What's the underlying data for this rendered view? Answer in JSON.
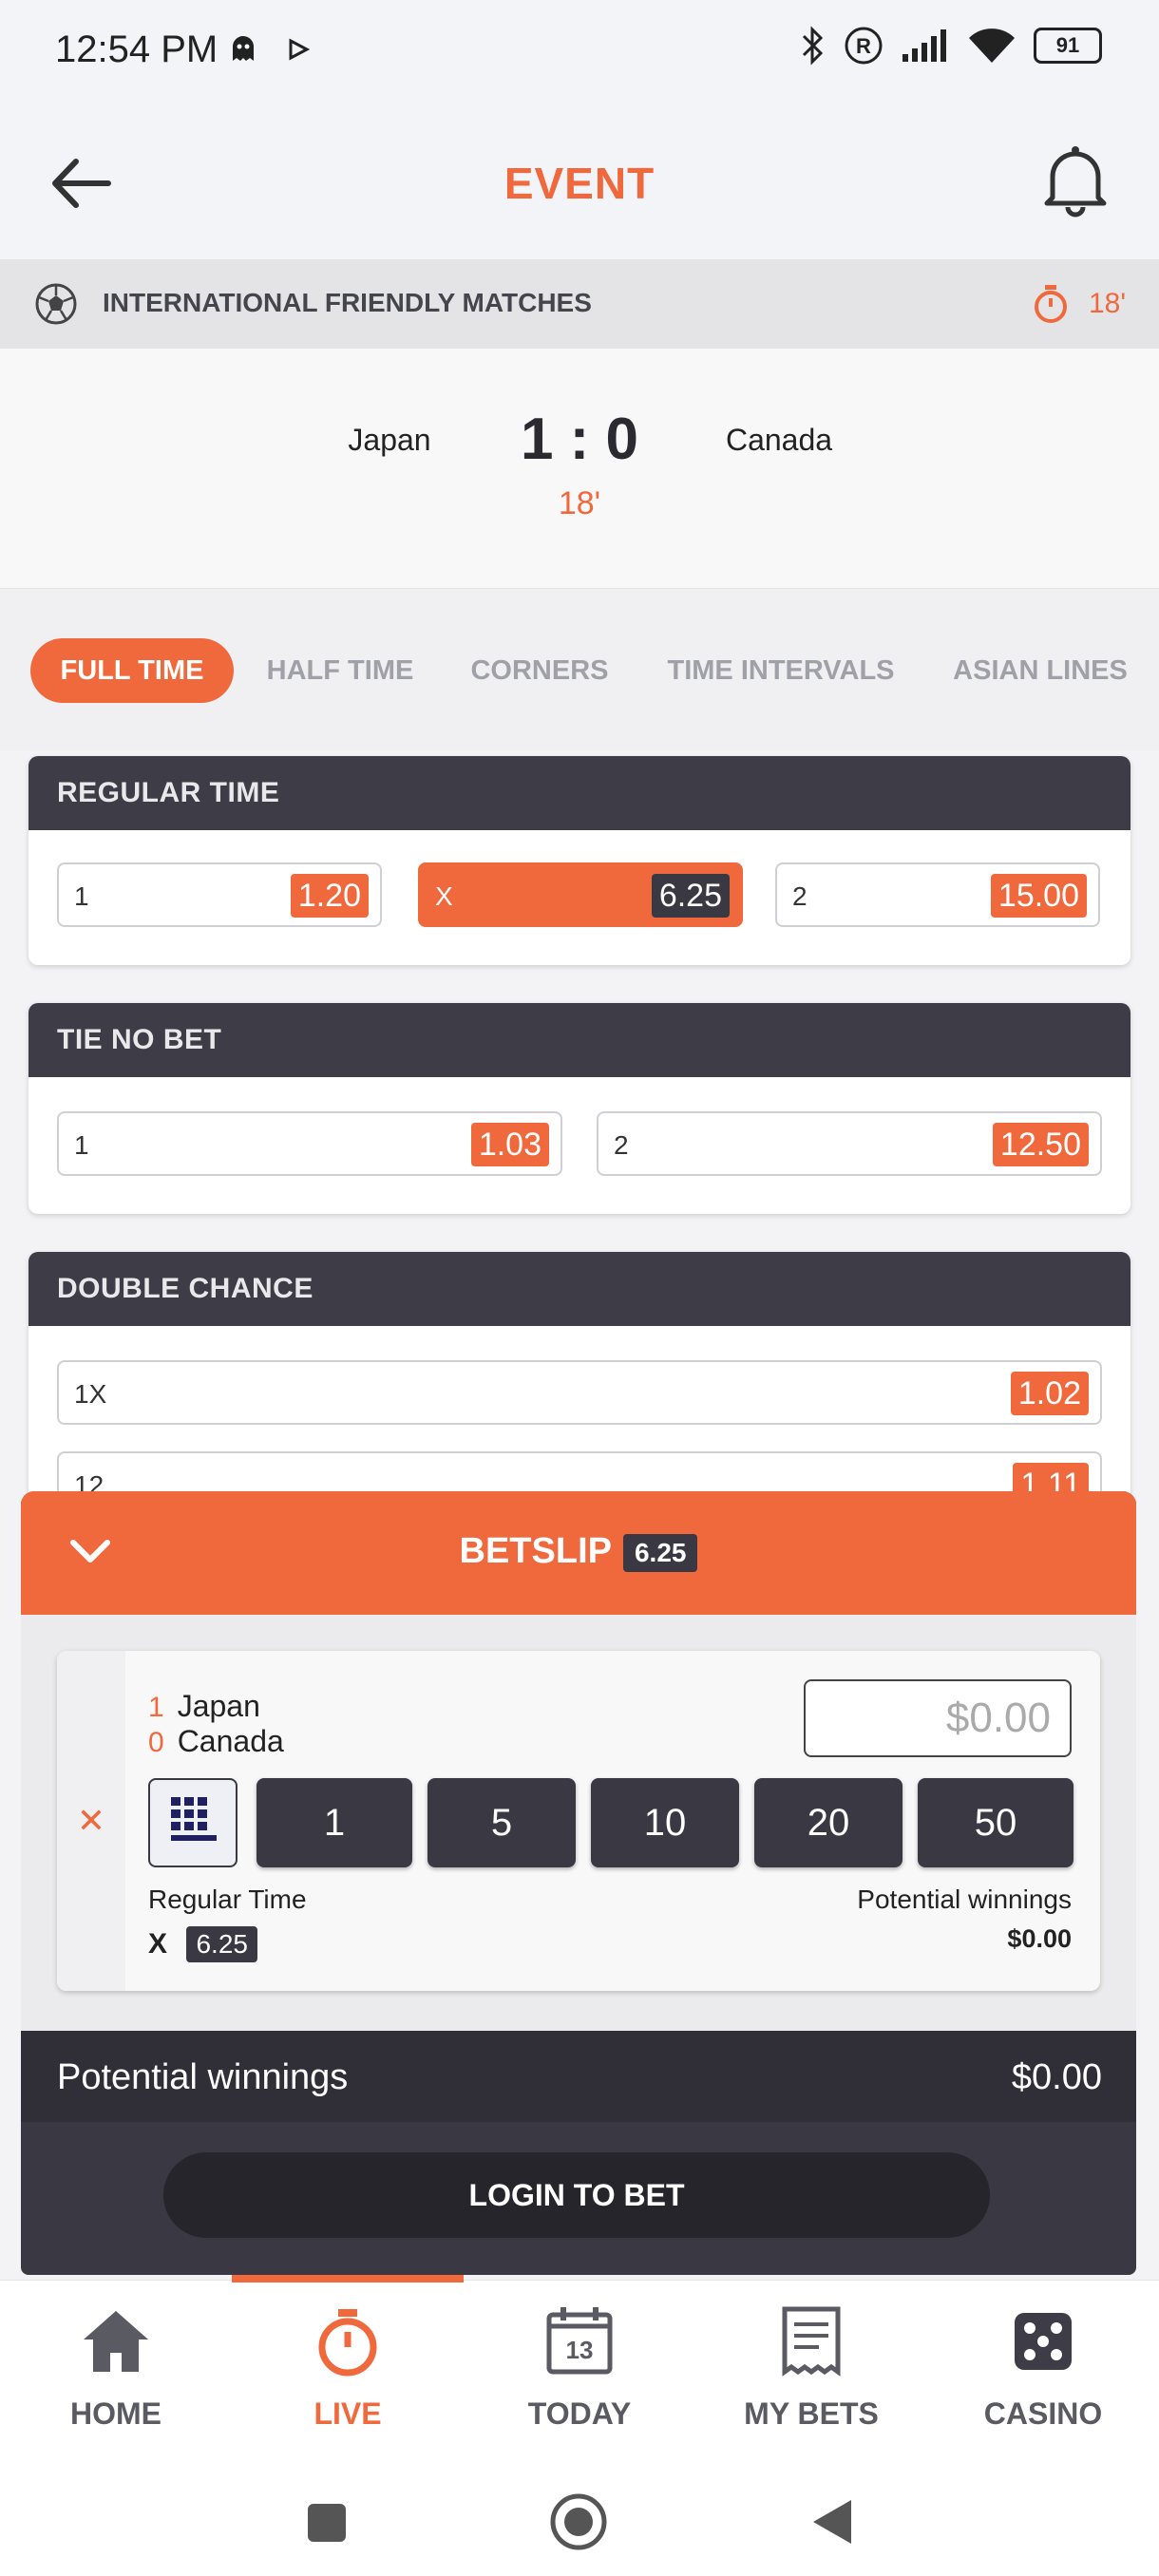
{
  "status_bar": {
    "time": "12:54 PM",
    "battery": "91"
  },
  "header": {
    "title": "EVENT"
  },
  "league": {
    "name": "INTERNATIONAL FRIENDLY MATCHES",
    "minute": "18'"
  },
  "match": {
    "home": "Japan",
    "away": "Canada",
    "score": "1 : 0",
    "minute": "18'"
  },
  "tabs": [
    "FULL TIME",
    "HALF TIME",
    "CORNERS",
    "TIME INTERVALS",
    "ASIAN LINES"
  ],
  "markets": {
    "regular_time": {
      "title": "REGULAR TIME",
      "odds": [
        {
          "label": "1",
          "value": "1.20"
        },
        {
          "label": "X",
          "value": "6.25"
        },
        {
          "label": "2",
          "value": "15.00"
        }
      ]
    },
    "tie_no_bet": {
      "title": "TIE NO BET",
      "odds": [
        {
          "label": "1",
          "value": "1.03"
        },
        {
          "label": "2",
          "value": "12.50"
        }
      ]
    },
    "double_chance": {
      "title": "DOUBLE CHANCE",
      "odds": [
        {
          "label": "1X",
          "value": "1.02"
        },
        {
          "label": "12",
          "value": "1.11"
        }
      ]
    }
  },
  "betslip": {
    "title": "BETSLIP",
    "total_odds": "6.25",
    "selection": {
      "home_score": "1",
      "home": "Japan",
      "away_score": "0",
      "away": "Canada",
      "stake_placeholder": "$0.00",
      "market": "Regular Time",
      "pick": "X",
      "odds": "6.25",
      "pw_label": "Potential winnings",
      "pw_value": "$0.00"
    },
    "quick_stakes": [
      "1",
      "5",
      "10",
      "20",
      "50"
    ],
    "potential_winnings_label": "Potential winnings",
    "potential_winnings_value": "$0.00",
    "login_label": "LOGIN TO BET"
  },
  "bottom_nav": {
    "home": "HOME",
    "live": "LIVE",
    "today": "TODAY",
    "my_bets": "MY BETS",
    "casino": "CASINO",
    "today_day": "13"
  },
  "colors": {
    "accent": "#f0693c",
    "dark": "#3a3842"
  }
}
